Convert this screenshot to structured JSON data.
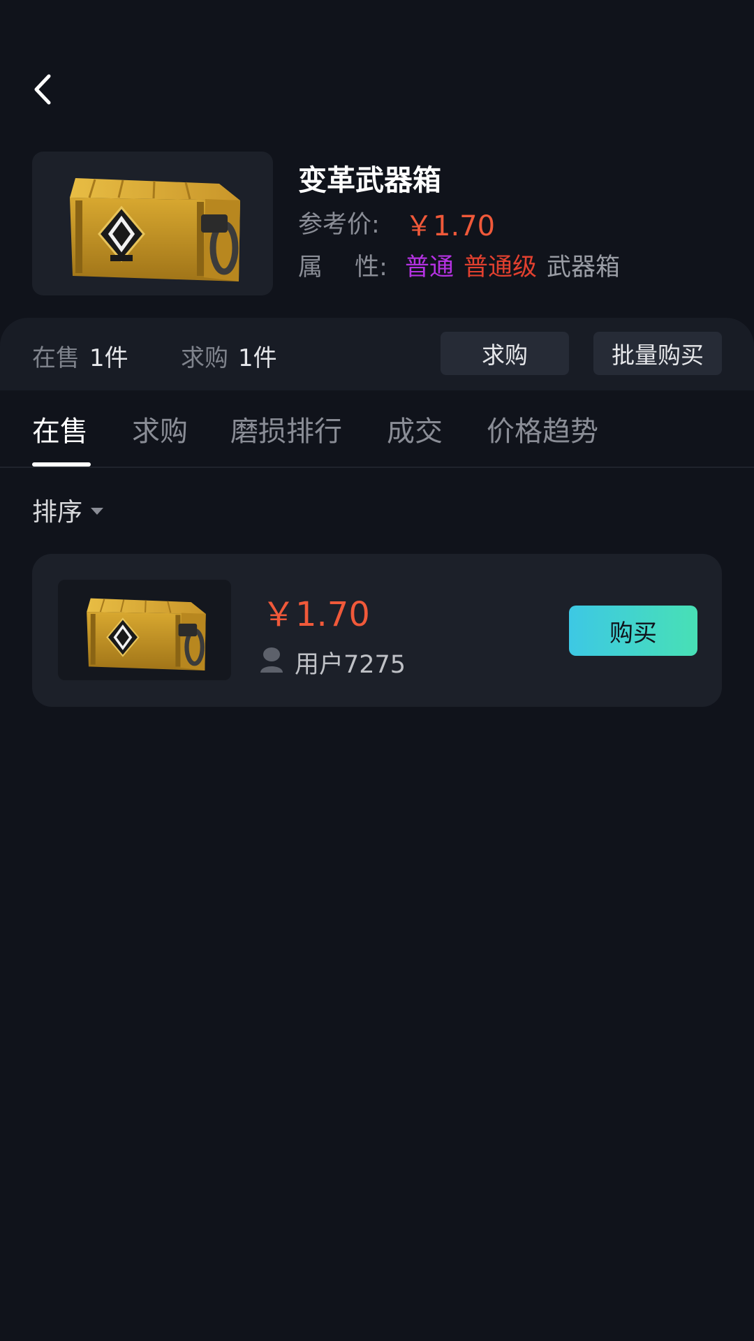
{
  "header": {
    "back_icon": "chevron-left-icon"
  },
  "product": {
    "title": "变革武器箱",
    "ref_price_label": "参考价:",
    "ref_price": "￥1.70",
    "attr_label": "属　 性:",
    "attributes": [
      {
        "text": "普通",
        "color": "#b532e2"
      },
      {
        "text": "普通级",
        "color": "#e2402f"
      },
      {
        "text": "武器箱",
        "color": "#9a9da5"
      }
    ],
    "image_icon": "weapon-case-image"
  },
  "stats": {
    "on_sale_label": "在售",
    "on_sale_value": "1件",
    "wanted_label": "求购",
    "wanted_value": "1件",
    "want_button": "求购",
    "bulk_button": "批量购买"
  },
  "tabs": [
    {
      "label": "在售",
      "active": true
    },
    {
      "label": "求购",
      "active": false
    },
    {
      "label": "磨损排行",
      "active": false
    },
    {
      "label": "成交",
      "active": false
    },
    {
      "label": "价格趋势",
      "active": false
    }
  ],
  "sort": {
    "label": "排序"
  },
  "listings": [
    {
      "price": "￥1.70",
      "user": "用户7275",
      "buy_label": "购买"
    }
  ],
  "colors": {
    "background": "#10131b",
    "price": "#f0593a",
    "buy_gradient_start": "#3dc8e4",
    "buy_gradient_end": "#48e0b5"
  }
}
